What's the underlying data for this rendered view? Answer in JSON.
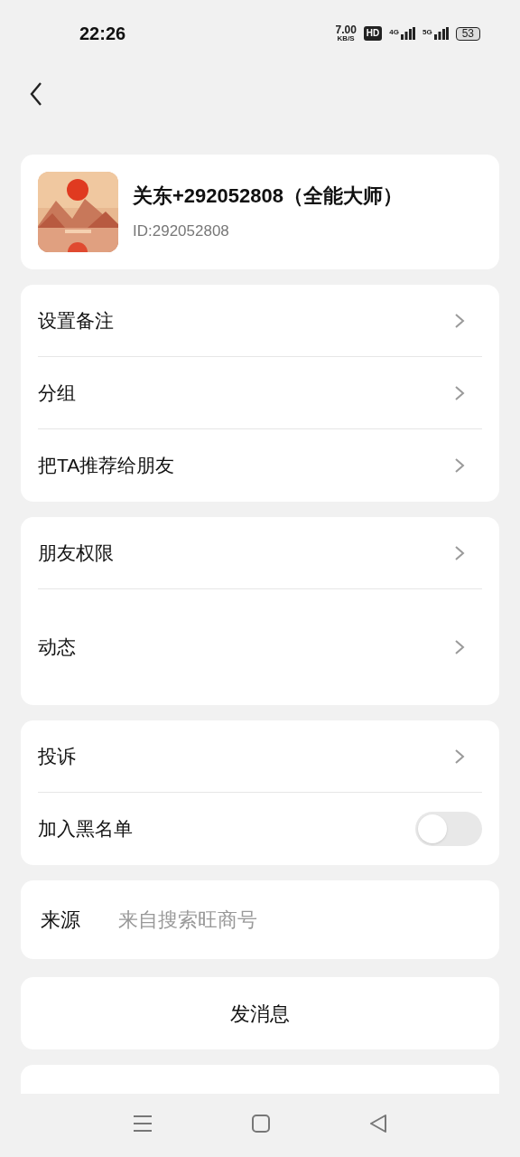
{
  "status_bar": {
    "time": "22:26",
    "speed": "7.00",
    "speed_unit": "KB/S",
    "hd": "HD",
    "net_1": "4G",
    "net_2": "5G",
    "battery": "53"
  },
  "profile": {
    "name": "关东+292052808（全能大师）",
    "id": "ID:292052808"
  },
  "groups": [
    {
      "rows": [
        {
          "kind": "chevron",
          "label": "设置备注"
        },
        {
          "kind": "chevron",
          "label": "分组"
        },
        {
          "kind": "chevron",
          "label": "把TA推荐给朋友"
        }
      ]
    },
    {
      "rows": [
        {
          "kind": "chevron",
          "label": "朋友权限"
        },
        {
          "kind": "chevron_tall",
          "label": "动态"
        }
      ]
    },
    {
      "rows": [
        {
          "kind": "chevron",
          "label": "投诉"
        },
        {
          "kind": "toggle",
          "label": "加入黑名单",
          "on": false
        }
      ]
    }
  ],
  "source": {
    "label": "来源",
    "value": "来自搜索旺商号"
  },
  "send_button": "发消息"
}
